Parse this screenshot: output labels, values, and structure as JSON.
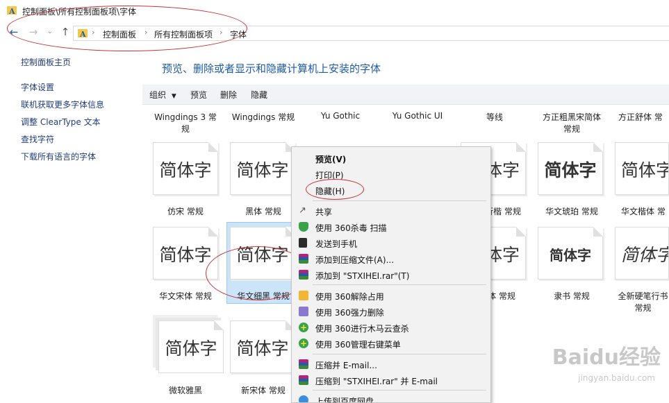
{
  "window": {
    "title": "控制面板\\所有控制面板项\\字体"
  },
  "address": {
    "crumbs": [
      "控制面板",
      "所有控制面板项",
      "字体"
    ]
  },
  "left_pane": {
    "home": "控制面板主页",
    "links": [
      "字体设置",
      "联机获取更多字体信息",
      "调整 ClearType 文本",
      "查找字符",
      "下载所有语言的字体"
    ]
  },
  "headline": "预览、删除或者显示和隐藏计算机上安装的字体",
  "toolbar": {
    "organize": "组织",
    "preview": "预览",
    "delete": "删除",
    "hide": "隐藏"
  },
  "sample_text": "简体字",
  "top_labels": [
    {
      "line1": "Wingdings 3 常",
      "line2": "规"
    },
    {
      "line1": "Wingdings 常规",
      "line2": ""
    },
    {
      "line1": "Yu Gothic",
      "line2": ""
    },
    {
      "line1": "Yu Gothic UI",
      "line2": ""
    },
    {
      "line1": "等线",
      "line2": ""
    },
    {
      "line1": "方正粗黑宋简体",
      "line2": "常规"
    },
    {
      "line1": "方正舒体 常",
      "line2": ""
    }
  ],
  "row1_labels": [
    "仿宋 常规",
    "黑体 常规",
    "",
    "",
    "行楷 常规",
    "华文琥珀 常规",
    "华文楷体 常"
  ],
  "row2_labels": [
    "华文宋体 常规",
    "华文细黑 常规",
    "",
    "",
    "体 常规",
    "隶书 常规",
    "全新硬笔行书"
  ],
  "row2_extra": "常规",
  "row3_labels": [
    "微软雅黑",
    "新宋体 常规"
  ],
  "row1_partial": "体字",
  "row2_partial": "体字",
  "context_menu": {
    "items": [
      {
        "label": "预览(V)",
        "bold": true
      },
      {
        "label": "打印(P)"
      },
      {
        "label": "隐藏(H)"
      },
      {
        "label": "共享",
        "icon": "share-icon"
      },
      {
        "label": "使用 360杀毒 扫描",
        "icon": "360-antivirus-icon"
      },
      {
        "label": "发送到手机",
        "icon": "send-to-phone-icon"
      },
      {
        "label": "添加到压缩文件(A)...",
        "icon": "winrar-icon"
      },
      {
        "label": "添加到 \"STXIHEI.rar\"(T)",
        "icon": "winrar-icon"
      },
      {
        "label": "使用 360解除占用",
        "icon": "360-unlock-icon"
      },
      {
        "label": "使用 360强力删除",
        "icon": "360-delete-icon"
      },
      {
        "label": "使用 360进行木马云查杀",
        "icon": "360-trojan-icon"
      },
      {
        "label": "使用 360管理右键菜单",
        "icon": "360-menu-icon"
      },
      {
        "label": "压缩并 E-mail...",
        "icon": "winrar-icon"
      },
      {
        "label": "压缩到 \"STXIHEI.rar\" 并 E-mail",
        "icon": "winrar-icon"
      },
      {
        "label": "上传到百度网盘",
        "icon": "baidu-cloud-icon"
      }
    ]
  },
  "watermark": {
    "brand": "Baidu经验",
    "url": "jingyan.baidu.com"
  },
  "colors": {
    "accent": "#1e5aa8",
    "selection": "#cce4f7",
    "annotation": "#c9303a"
  }
}
